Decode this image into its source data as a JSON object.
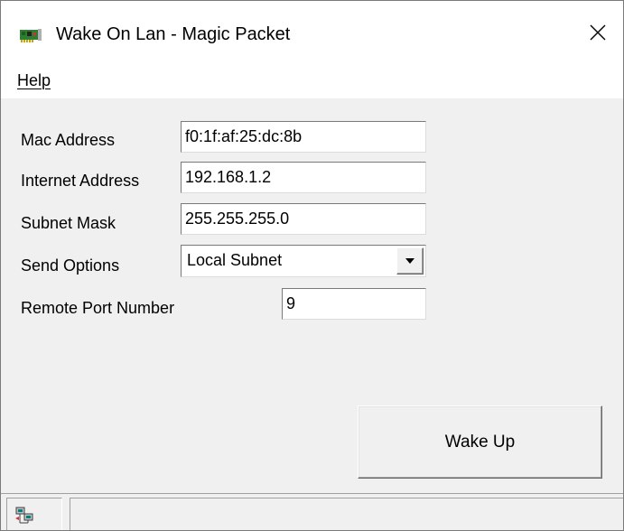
{
  "window": {
    "title": "Wake On Lan - Magic Packet",
    "close_glyph": "✕"
  },
  "menu": {
    "help_accel": "H",
    "help_rest": "elp"
  },
  "form": {
    "mac_label": "Mac Address",
    "mac_value": "f0:1f:af:25:dc:8b",
    "ip_label": "Internet Address",
    "ip_value": "192.168.1.2",
    "subnet_label": "Subnet Mask",
    "subnet_value": "255.255.255.0",
    "send_label": "Send Options",
    "send_value": "Local Subnet",
    "port_label": "Remote Port Number",
    "port_value": "9"
  },
  "actions": {
    "wake_label": "Wake Up"
  },
  "statusbar": {
    "icon": "network-computers-icon",
    "text": ""
  },
  "colors": {
    "window_bg": "#f0f0f0",
    "titlebar_bg": "#ffffff",
    "field_bg": "#ffffff"
  }
}
